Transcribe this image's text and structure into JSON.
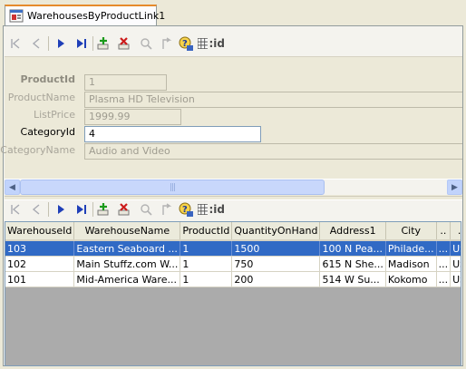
{
  "tab": {
    "label": "WarehousesByProductLink1"
  },
  "form": {
    "fields": [
      {
        "label": "ProductId",
        "value": "1"
      },
      {
        "label": "ProductName",
        "value": "Plasma HD Television"
      },
      {
        "label": "ListPrice",
        "value": "1999.99"
      },
      {
        "label": "CategoryId",
        "value": "4"
      },
      {
        "label": "CategoryName",
        "value": "Audio and Video"
      }
    ]
  },
  "toolbar": {
    "icons": [
      "first-record-icon",
      "previous-record-icon",
      "next-record-icon",
      "last-record-icon",
      "add-record-icon",
      "delete-record-icon",
      "refresh-icon",
      "undo-icon",
      "query-icon",
      "id-icon"
    ],
    "id_label": ":id"
  },
  "grid": {
    "columns": [
      "WarehouseId",
      "WarehouseName",
      "ProductId",
      "QuantityOnHand",
      "Address1",
      "City",
      "..",
      "."
    ],
    "rows": [
      [
        "103",
        "Eastern Seaboard ...",
        "1",
        "1500",
        "100 N Pea...",
        "Philade...",
        "...",
        "US"
      ],
      [
        "102",
        "Main Stuffz.com W...",
        "1",
        "750",
        "615 N She...",
        "Madison",
        "...",
        "US"
      ],
      [
        "101",
        "Mid-America Ware...",
        "1",
        "200",
        "514 W Su...",
        "Kokomo",
        "...",
        "US"
      ]
    ],
    "selected_row": 0
  },
  "colors": {
    "selection": "#316ac5",
    "tab_accent": "#e68b2c",
    "scrollbar": "#c1d3fb"
  }
}
